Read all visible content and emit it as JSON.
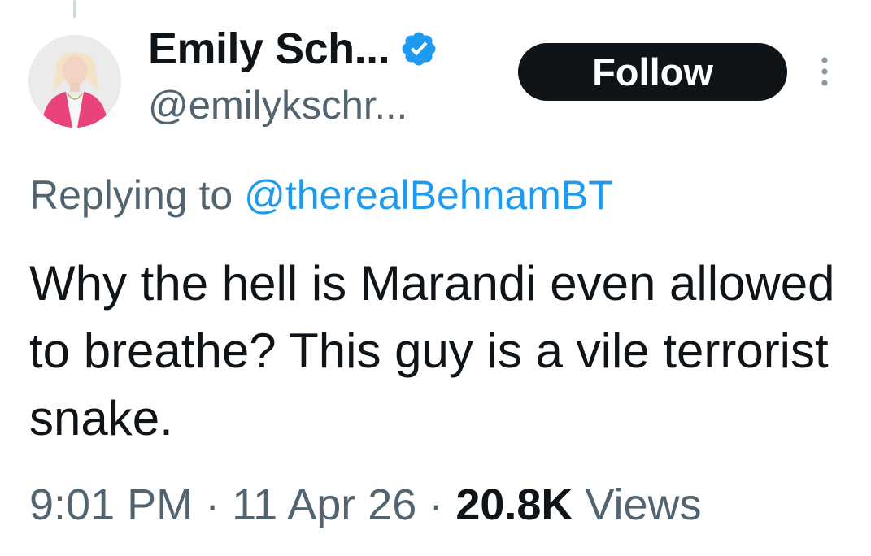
{
  "author": {
    "display_name": "Emily Sch...",
    "handle": "@emilykschr...",
    "verified_color": "#1d9bf0"
  },
  "actions": {
    "follow_label": "Follow",
    "more_icon": "more-vertical-icon"
  },
  "reply": {
    "prefix": "Replying to",
    "mention": "@therealBehnamBT"
  },
  "tweet": {
    "text": "Why the hell is Marandi even allowed to breathe? This guy is a vile terrorist snake."
  },
  "meta": {
    "time": "9:01 PM",
    "separator": "·",
    "date": "11 Apr 26",
    "views_count": "20.8K",
    "views_label": "Views"
  },
  "colors": {
    "text_primary": "#0f1419",
    "text_secondary": "#536471",
    "accent": "#1d9bf0",
    "avatar_jacket": "#e8447a"
  }
}
